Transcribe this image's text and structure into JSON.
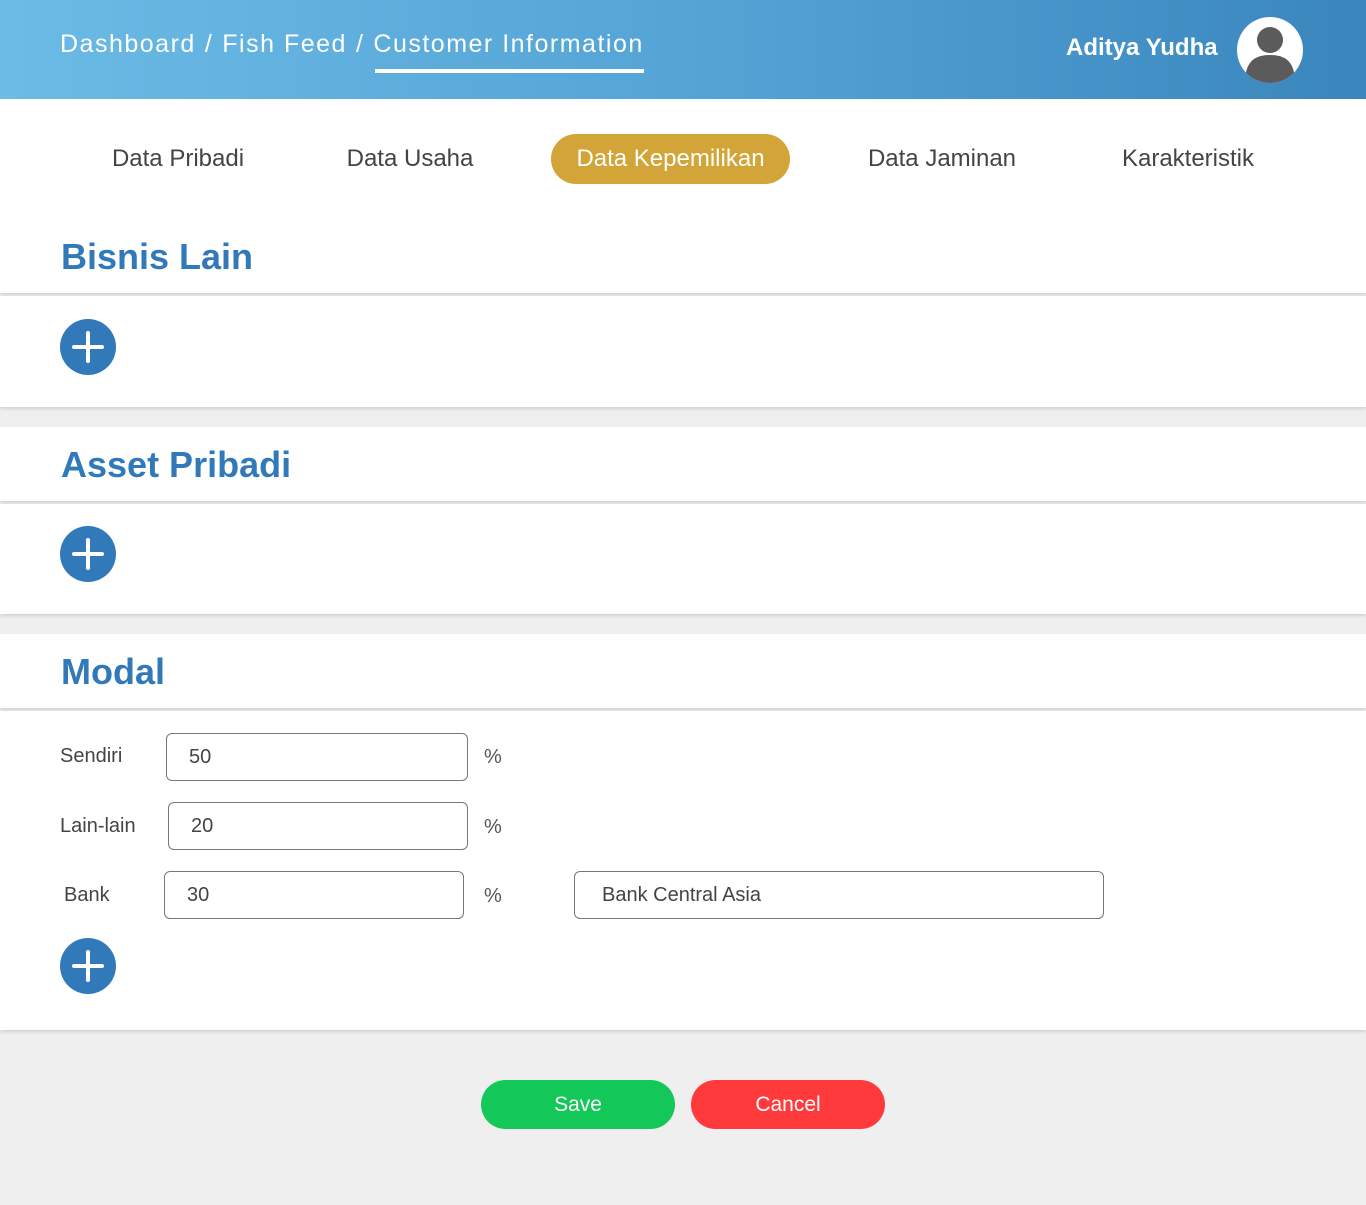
{
  "header": {
    "breadcrumb": [
      "Dashboard",
      "Fish Feed",
      "Customer Information"
    ],
    "separator": "/",
    "username": "Aditya Yudha"
  },
  "tabs": [
    {
      "label": "Data Pribadi"
    },
    {
      "label": "Data Usaha"
    },
    {
      "label": "Data Kepemilikan",
      "active": true
    },
    {
      "label": "Data Jaminan"
    },
    {
      "label": "Karakteristik"
    }
  ],
  "sections": {
    "bisnis_lain": {
      "title": "Bisnis Lain"
    },
    "asset_pribadi": {
      "title": "Asset Pribadi"
    },
    "modal": {
      "title": "Modal",
      "fields": [
        {
          "label": "Sendiri",
          "value": "50",
          "unit": "%"
        },
        {
          "label": "Lain-lain",
          "value": "20",
          "unit": "%"
        },
        {
          "label": "Bank",
          "value": "30",
          "unit": "%",
          "bank_name": "Bank Central Asia"
        }
      ]
    }
  },
  "actions": {
    "save": "Save",
    "cancel": "Cancel"
  },
  "colors": {
    "accent": "#3179b9",
    "active_tab": "#d3a437",
    "save": "#13c759",
    "cancel": "#fe3a3c"
  },
  "icons": {
    "add": "plus-icon",
    "avatar": "user-avatar-icon"
  }
}
